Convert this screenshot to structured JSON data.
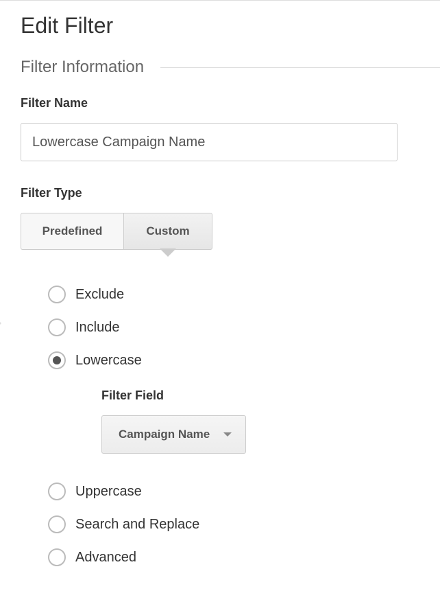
{
  "page_title": "Edit Filter",
  "section_title": "Filter Information",
  "filter_name": {
    "label": "Filter Name",
    "value": "Lowercase Campaign Name"
  },
  "filter_type": {
    "label": "Filter Type",
    "tabs": {
      "predefined": "Predefined",
      "custom": "Custom"
    }
  },
  "radios": {
    "exclude": "Exclude",
    "include": "Include",
    "lowercase": "Lowercase",
    "uppercase": "Uppercase",
    "search_replace": "Search and Replace",
    "advanced": "Advanced"
  },
  "filter_field": {
    "label": "Filter Field",
    "value": "Campaign Name"
  }
}
